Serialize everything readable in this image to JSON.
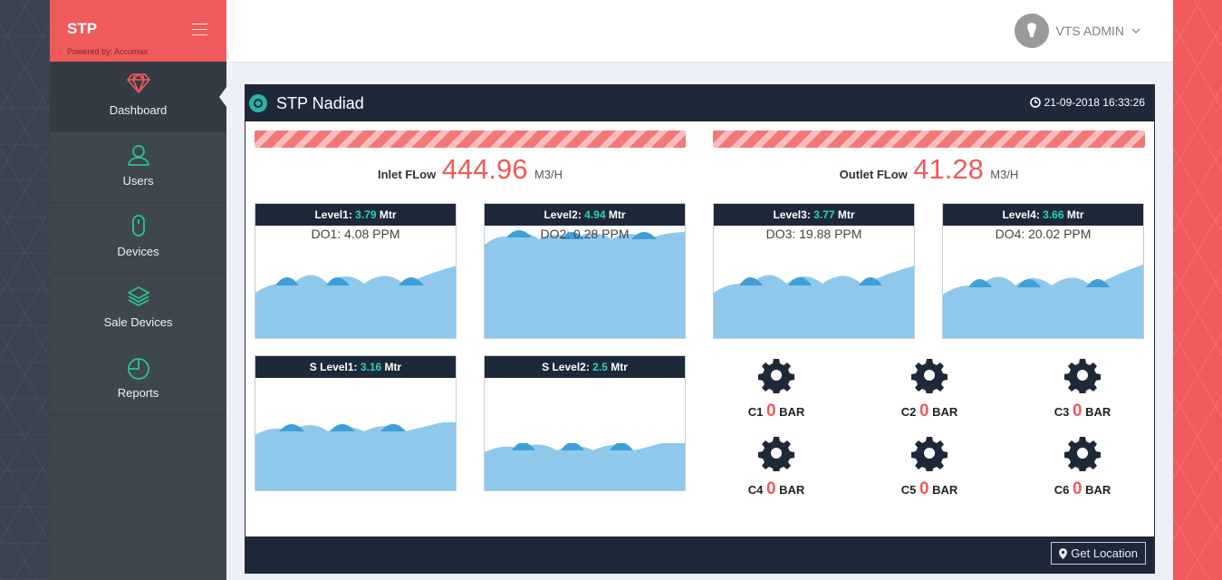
{
  "sidebar": {
    "brand": "STP",
    "powered_by": "Powered by: Accumax",
    "items": [
      {
        "label": "Dashboard"
      },
      {
        "label": "Users"
      },
      {
        "label": "Devices"
      },
      {
        "label": "Sale Devices"
      },
      {
        "label": "Reports"
      }
    ]
  },
  "header": {
    "user_name": "VTS ADMIN"
  },
  "panel": {
    "title": "STP Nadiad",
    "datetime": "21-09-2018 16:33:26",
    "inlet": {
      "label": "Inlet FLow",
      "value": "444.96",
      "unit": "M3/H"
    },
    "outlet": {
      "label": "Outlet FLow",
      "value": "41.28",
      "unit": "M3/H"
    },
    "levels": [
      {
        "label": "Level1:",
        "value": "3.79",
        "unit": "Mtr",
        "do": "DO1: 4.08 PPM"
      },
      {
        "label": "Level2:",
        "value": "4.94",
        "unit": "Mtr",
        "do": "DO2: 0.28 PPM"
      },
      {
        "label": "Level3:",
        "value": "3.77",
        "unit": "Mtr",
        "do": "DO3: 19.88 PPM"
      },
      {
        "label": "Level4:",
        "value": "3.66",
        "unit": "Mtr",
        "do": "DO4: 20.02 PPM"
      }
    ],
    "slevels": [
      {
        "label": "S Level1:",
        "value": "3.16",
        "unit": "Mtr"
      },
      {
        "label": "S Level2:",
        "value": "2.5",
        "unit": "Mtr"
      }
    ],
    "compressors": [
      {
        "label": "C1",
        "value": "0",
        "unit": "BAR"
      },
      {
        "label": "C2",
        "value": "0",
        "unit": "BAR"
      },
      {
        "label": "C3",
        "value": "0",
        "unit": "BAR"
      },
      {
        "label": "C4",
        "value": "0",
        "unit": "BAR"
      },
      {
        "label": "C5",
        "value": "0",
        "unit": "BAR"
      },
      {
        "label": "C6",
        "value": "0",
        "unit": "BAR"
      }
    ],
    "get_location": "Get Location"
  },
  "colors": {
    "accent": "#f15a5a",
    "dark": "#1d2939",
    "teal": "#2bd3b9",
    "water": "#8ec9ec",
    "wave": "#3f9fd8"
  }
}
